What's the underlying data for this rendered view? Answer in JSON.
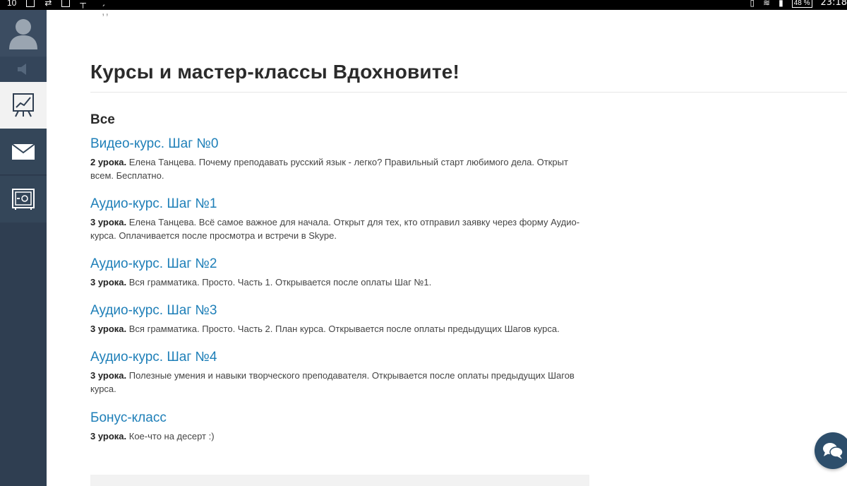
{
  "status_bar": {
    "left_text": "10",
    "battery": "48 %",
    "time": "23:18"
  },
  "sidebar": {
    "items": [
      {
        "name": "avatar",
        "icon": "user-icon"
      },
      {
        "name": "sound",
        "icon": "speaker-icon"
      },
      {
        "name": "courses",
        "icon": "chart-easel-icon",
        "active": true
      },
      {
        "name": "messages",
        "icon": "mail-icon"
      },
      {
        "name": "safe",
        "icon": "safe-icon"
      }
    ]
  },
  "main": {
    "scribble": ",́́́́́,",
    "page_title": "Курсы и мастер-классы Вдохновите!",
    "section_title": "Все",
    "courses": [
      {
        "title": "Видео-курс. Шаг №0",
        "lessons": "2 урока.",
        "desc": " Елена Танцева. Почему преподавать русский язык - легко? Правильный старт любимого дела. Открыт всем. Бесплатно."
      },
      {
        "title": "Аудио-курс. Шаг №1",
        "lessons": "3 урока.",
        "desc": " Елена Танцева. Всё самое важное для начала. Открыт для тех, кто отправил заявку через форму Аудио-курса. Оплачивается после просмотра и встречи в Skype."
      },
      {
        "title": "Аудио-курс. Шаг №2",
        "lessons": "3 урока.",
        "desc": " Вся грамматика. Просто. Часть 1. Открывается после оплаты Шаг №1."
      },
      {
        "title": "Аудио-курс. Шаг №3",
        "lessons": "3 урока.",
        "desc": " Вся грамматика. Просто. Часть 2. План курса. Открывается после оплаты предыдущих Шагов курса."
      },
      {
        "title": "Аудио-курс. Шаг №4",
        "lessons": "3 урока.",
        "desc": " Полезные умения и навыки творческого преподавателя. Открывается после оплаты предыдущих Шагов курса."
      },
      {
        "title": "Бонус-класс",
        "lessons": "3 урока.",
        "desc": " Кое-что на десерт :)"
      }
    ]
  },
  "colors": {
    "sidebar": "#2f3e51",
    "link": "#1e7fb8",
    "chat_button": "#2d4e6b"
  },
  "chat": {
    "icon": "chat-bubbles-icon"
  }
}
